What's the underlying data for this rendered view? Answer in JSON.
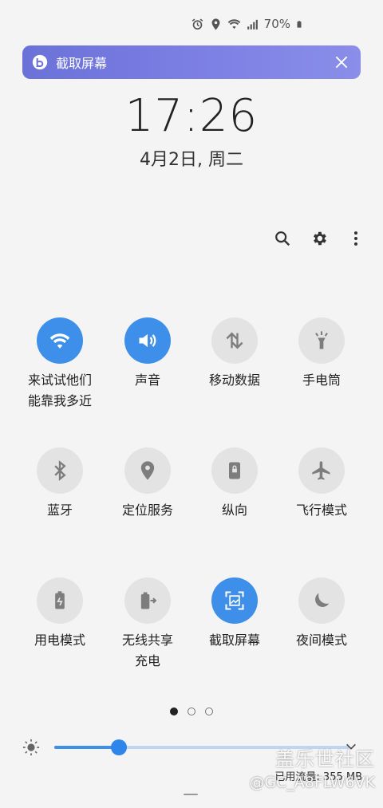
{
  "status_bar": {
    "battery": "70%"
  },
  "banner": {
    "label": "截取屏幕",
    "color_start": "#6a72d8",
    "color_end": "#8a8ee9"
  },
  "clock": {
    "time": "17:26",
    "date": "4月2日, 周二"
  },
  "tiles": [
    {
      "label": "来试试他们\n能靠我多近",
      "state": "on",
      "icon": "wifi-icon"
    },
    {
      "label": "声音",
      "state": "on",
      "icon": "volume-icon"
    },
    {
      "label": "移动数据",
      "state": "off",
      "icon": "mobile-data-icon"
    },
    {
      "label": "手电筒",
      "state": "off",
      "icon": "flashlight-icon"
    },
    {
      "label": "蓝牙",
      "state": "off",
      "icon": "bluetooth-icon"
    },
    {
      "label": "定位服务",
      "state": "off",
      "icon": "location-icon"
    },
    {
      "label": "纵向",
      "state": "off",
      "icon": "portrait-lock-icon"
    },
    {
      "label": "飞行模式",
      "state": "off",
      "icon": "airplane-icon"
    },
    {
      "label": "用电模式",
      "state": "off",
      "icon": "power-mode-icon"
    },
    {
      "label": "无线共享\n充电",
      "state": "off",
      "icon": "wireless-share-icon"
    },
    {
      "label": "截取屏幕",
      "state": "on",
      "icon": "screenshot-icon"
    },
    {
      "label": "夜间模式",
      "state": "off",
      "icon": "night-mode-icon"
    }
  ],
  "pagination": {
    "current": 1,
    "total": 3
  },
  "brightness": {
    "level": 0.22
  },
  "data_usage": "已用流量: 355 MB",
  "watermark": {
    "brand": "盖乐世社区",
    "user": "@GC_A8FLW6VK"
  },
  "accent_color": "#3e8fe9"
}
